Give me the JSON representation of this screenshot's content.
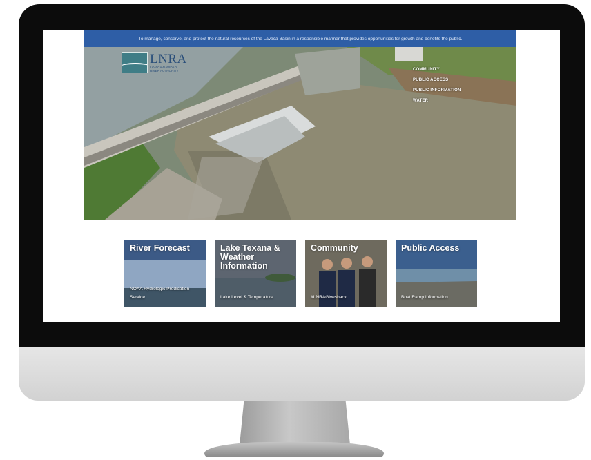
{
  "banner": {
    "mission": "To manage, conserve, and protect the natural resources of the Lavaca Basin in a responsible manner that provides opportunities for growth and benefits the public."
  },
  "logo": {
    "acronym": "LNRA",
    "line1": "LAVACA-NAVIDAD",
    "line2": "RIVER AUTHORITY",
    "box_text": "Manage Conserve Protect"
  },
  "nav": {
    "items": [
      "COMMUNITY",
      "PUBLIC ACCESS",
      "PUBLIC INFORMATION",
      "WATER"
    ]
  },
  "cards": [
    {
      "title": "River Forecast",
      "subtitle": "NOAA Hydrologic Predication Service"
    },
    {
      "title": "Lake Texana & Weather Information",
      "subtitle": "Lake Level & Temperature"
    },
    {
      "title": "Community",
      "subtitle": "#LNRAGivesback"
    },
    {
      "title": "Public Access",
      "subtitle": "Boat Ramp Information"
    }
  ],
  "colors": {
    "banner": "#2e5ea6",
    "bezel": "#0c0c0c",
    "chin": "#dcdcdc"
  }
}
